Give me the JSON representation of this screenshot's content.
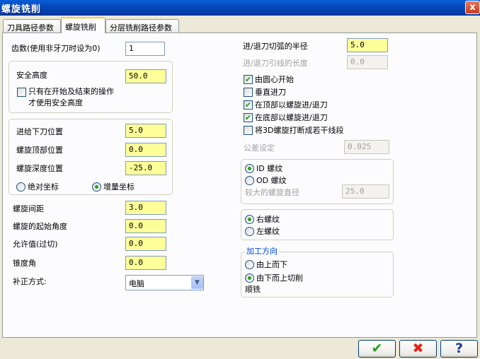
{
  "window": {
    "title": "螺旋铣削",
    "close_glyph": "x"
  },
  "tabs": [
    {
      "label": "刀具路径参数"
    },
    {
      "label": "螺旋铣削"
    },
    {
      "label": "分层铣削路径参数"
    }
  ],
  "left": {
    "teeth": {
      "label": "齿数(使用非牙刀时设为0)",
      "value": "1"
    },
    "safety": {
      "label": "安全高度",
      "value": "50.0",
      "check_line1": "只有在开始及结束的操作",
      "check_line2": "才使用安全高度",
      "checked": false
    },
    "feed": {
      "label": "进给下刀位置",
      "value": "5.0"
    },
    "top": {
      "label": "螺旋顶部位置",
      "value": "0.0"
    },
    "depth": {
      "label": "螺旋深度位置",
      "value": "-25.0"
    },
    "coord": {
      "absolute": "绝对坐标",
      "incremental": "增量坐标",
      "selected": "incremental"
    },
    "pitch": {
      "label": "螺旋间距",
      "value": "3.0"
    },
    "start_angle": {
      "label": "螺旋的起始角度",
      "value": "0.0"
    },
    "allowance": {
      "label": "允许值(过切)",
      "value": "0.0"
    },
    "taper": {
      "label": "锥度角",
      "value": "0.0"
    },
    "comp": {
      "label": "补正方式:",
      "value": "电脑"
    }
  },
  "right": {
    "radius": {
      "label": "进/退刀切弧的半径",
      "value": "5.0"
    },
    "lead": {
      "label": "进/退刀引线的长度",
      "value": "0.0"
    },
    "checks": [
      {
        "label": "由圆心开始",
        "checked": true
      },
      {
        "label": "垂直进刀",
        "checked": false
      },
      {
        "label": "在顶部以螺旋进/退刀",
        "checked": true
      },
      {
        "label": "在底部以螺旋进/退刀",
        "checked": true
      },
      {
        "label": "将3D螺旋打断成若干线段",
        "checked": false
      }
    ],
    "tolerance": {
      "label": "公差设定",
      "value": "0.025"
    },
    "thread_type": {
      "id": "ID 螺纹",
      "od": "OD 螺纹",
      "selected": "id"
    },
    "major_dia": {
      "label": "较大的螺旋直径",
      "value": "25.0"
    },
    "hand": {
      "right": "右螺纹",
      "left": "左螺纹",
      "selected": "right"
    },
    "direction": {
      "legend": "加工方向",
      "top_down": "由上而下",
      "bottom_up": "由下而上切削",
      "climb": "顺铣",
      "selected": "bottom_up"
    }
  },
  "buttons": {
    "ok": "✔",
    "cancel": "✖",
    "help": "?"
  },
  "colors": {
    "field_bg": "#ffff99",
    "titlebar": "#0548b8",
    "check_green": "#21a121"
  }
}
